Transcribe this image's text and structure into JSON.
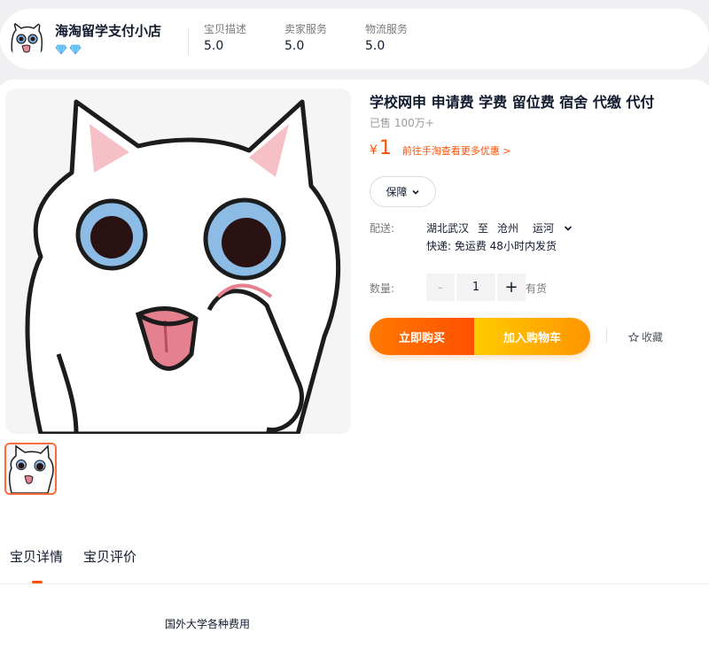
{
  "shop": {
    "name": "海淘留学支付小店",
    "badge_icon": "diamond-icon",
    "badge_color": "#6cc6ff",
    "scores": [
      {
        "label": "宝贝描述",
        "value": "5.0"
      },
      {
        "label": "卖家服务",
        "value": "5.0"
      },
      {
        "label": "物流服务",
        "value": "5.0"
      }
    ]
  },
  "product": {
    "title": "学校网申 申请费 学费 留位费 宿舍 代缴 代付",
    "sold": "已售 100万+",
    "price_currency": "¥",
    "price_value": "1",
    "promo_link": "前往手淘查看更多优惠 >",
    "guarantee_label": "保障",
    "delivery": {
      "label": "配送:",
      "from": "湖北武汉",
      "to_word": "至",
      "city": "沧州",
      "district": "运河",
      "sub": "快递: 免运费   48小时内发货"
    },
    "quantity": {
      "label": "数量:",
      "minus": "-",
      "value": "1",
      "plus": "+",
      "stock": "有货"
    },
    "buy_now_label": "立即购买",
    "add_cart_label": "加入购物车",
    "favorite_label": "收藏"
  },
  "colors": {
    "accent": "#ff5000",
    "buy_gradient_start": "#ff7a00",
    "cart_gradient_start": "#ffcb00"
  },
  "tabs": [
    {
      "label": "宝贝详情",
      "active": true
    },
    {
      "label": "宝贝评价",
      "active": false
    }
  ],
  "detail": {
    "text": "国外大学各种费用"
  }
}
